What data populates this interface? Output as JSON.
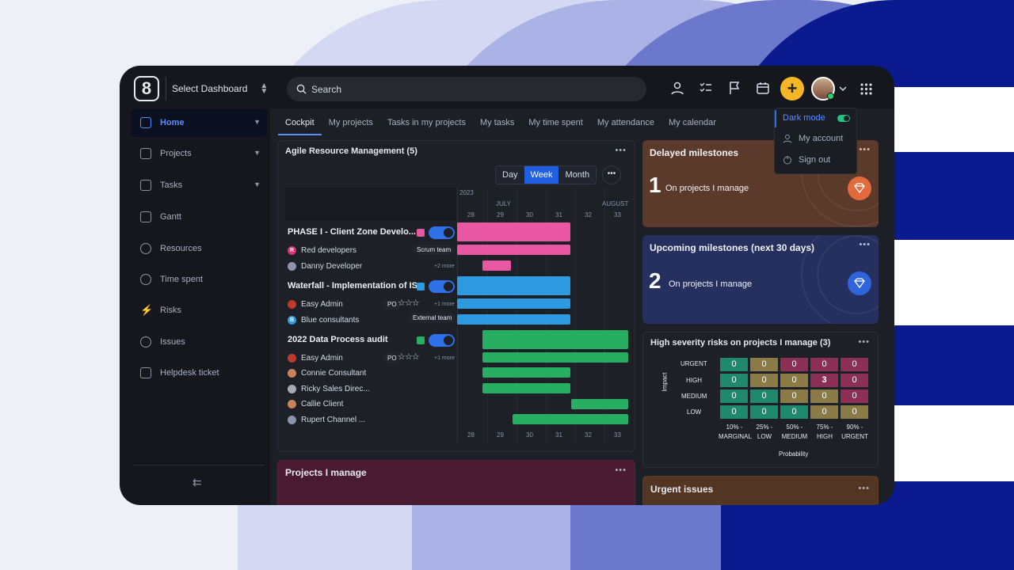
{
  "header": {
    "select_dashboard": "Select Dashboard",
    "search_placeholder": "Search",
    "logo_text": "8"
  },
  "sidebar": {
    "items": [
      {
        "label": "Home",
        "icon": "home-icon"
      },
      {
        "label": "Projects",
        "icon": "projects-icon"
      },
      {
        "label": "Tasks",
        "icon": "tasks-icon"
      },
      {
        "label": "Gantt",
        "icon": "gantt-icon"
      },
      {
        "label": "Resources",
        "icon": "resources-icon"
      },
      {
        "label": "Time spent",
        "icon": "clock-icon"
      },
      {
        "label": "Risks",
        "icon": "risks-icon"
      },
      {
        "label": "Issues",
        "icon": "issues-icon"
      },
      {
        "label": "Helpdesk ticket",
        "icon": "helpdesk-icon"
      }
    ]
  },
  "tabs": [
    "Cockpit",
    "My projects",
    "Tasks in my projects",
    "My tasks",
    "My time spent",
    "My attendance",
    "My calendar"
  ],
  "dropdown": {
    "dark_mode": "Dark mode",
    "my_account": "My account",
    "sign_out": "Sign out"
  },
  "agile": {
    "title": "Agile Resource Management (5)",
    "view_day": "Day",
    "view_week": "Week",
    "view_month": "Month",
    "year": "2023",
    "months": [
      "JULY",
      "AUGUST"
    ],
    "weeks": [
      "28",
      "29",
      "30",
      "31",
      "32",
      "33"
    ],
    "groups": [
      {
        "title": "PHASE I - Client Zone Develo...",
        "color": "#e957a3",
        "people": [
          {
            "name": "Red developers",
            "initial": "R",
            "avatar_color": "#e0306f"
          },
          {
            "name": "Danny Developer",
            "initial": "",
            "avatar_color": "#8a94b0"
          }
        ],
        "tag": "Scrum team",
        "more": "+2 more"
      },
      {
        "title": "Waterfall - Implementation of IS",
        "color": "#2e9ae0",
        "people": [
          {
            "name": "Easy Admin",
            "initial": "",
            "avatar_color": "#c0392b"
          },
          {
            "name": "Blue consultants",
            "initial": "B",
            "avatar_color": "#2e9ae0"
          }
        ],
        "badge": "PO",
        "tag": "External team",
        "more": "+1 more"
      },
      {
        "title": "2022 Data Process audit",
        "color": "#27ae60",
        "people": [
          {
            "name": "Easy Admin",
            "initial": "",
            "avatar_color": "#c0392b"
          },
          {
            "name": "Connie Consultant",
            "initial": "",
            "avatar_color": "#c9825a"
          },
          {
            "name": "Ricky Sales Direc...",
            "initial": "",
            "avatar_color": "#a7a9b5"
          },
          {
            "name": "Callie Client",
            "initial": "",
            "avatar_color": "#c9825a"
          },
          {
            "name": "Rupert Channel ...",
            "initial": "",
            "avatar_color": "#8a94b0"
          }
        ],
        "badge": "PO",
        "more": "+1 more"
      }
    ]
  },
  "projects_manage": {
    "title": "Projects I manage"
  },
  "delayed": {
    "title": "Delayed milestones",
    "count": "1",
    "subtitle": "On projects I manage",
    "bg": "#5b3a2c"
  },
  "upcoming": {
    "title": "Upcoming milestones (next 30 days)",
    "count": "2",
    "subtitle": "On projects I manage",
    "bg": "#25305e"
  },
  "risks": {
    "title": "High severity risks on projects I manage (3)",
    "impact_label": "Impact",
    "probability_label": "Probability",
    "rows": [
      "URGENT",
      "HIGH",
      "MEDIUM",
      "LOW"
    ],
    "cols": [
      [
        "10% -",
        "MARGINAL"
      ],
      [
        "25% -",
        "LOW"
      ],
      [
        "50% -",
        "MEDIUM"
      ],
      [
        "75% -",
        "HIGH"
      ],
      [
        "90% -",
        "URGENT"
      ]
    ],
    "values": [
      [
        "0",
        "0",
        "0",
        "0",
        "0"
      ],
      [
        "0",
        "0",
        "0",
        "3",
        "0"
      ],
      [
        "0",
        "0",
        "0",
        "0",
        "0"
      ],
      [
        "0",
        "0",
        "0",
        "0",
        "0"
      ]
    ],
    "colors": [
      [
        "#1f8a6b",
        "#8a7a45",
        "#8c2f55",
        "#8c2f55",
        "#8c2f55"
      ],
      [
        "#1f8a6b",
        "#8a7a45",
        "#8a7a45",
        "#8c2f55",
        "#8c2f55"
      ],
      [
        "#1f8a6b",
        "#1f8a6b",
        "#8a7a45",
        "#8a7a45",
        "#8c2f55"
      ],
      [
        "#1f8a6b",
        "#1f8a6b",
        "#1f8a6b",
        "#8a7a45",
        "#8a7a45"
      ]
    ]
  },
  "urgent_issues": {
    "title": "Urgent issues"
  }
}
